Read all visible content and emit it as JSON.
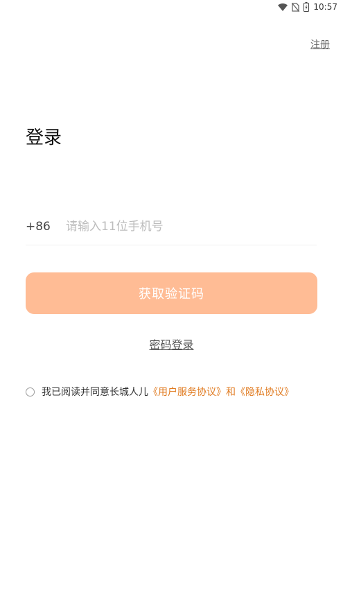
{
  "status_bar": {
    "time": "10:57",
    "icons": [
      "wifi-icon",
      "no-sim-icon",
      "battery-charging-icon"
    ]
  },
  "header": {
    "register_label": "注册"
  },
  "main": {
    "title": "登录",
    "country_code": "+86",
    "phone_placeholder": "请输入11位手机号",
    "phone_value": "",
    "get_code_label": "获取验证码",
    "password_login_label": "密码登录"
  },
  "agreement": {
    "prefix": "我已阅读并同意长城人儿",
    "service_link": "《用户服务协议》",
    "and": "和",
    "privacy_link": "《隐私协议》",
    "checked": false
  },
  "colors": {
    "accent_button": "#ffbc95",
    "link_orange": "#e07a1f"
  }
}
